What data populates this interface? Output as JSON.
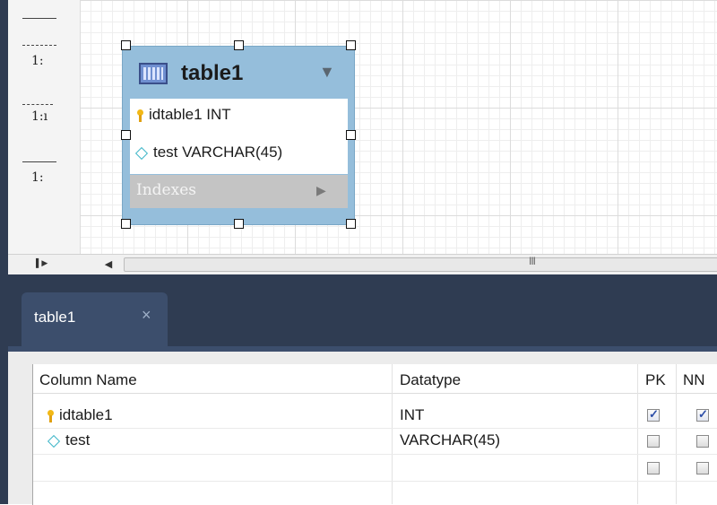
{
  "palette": {
    "items": [
      {
        "label": "1:"
      },
      {
        "label": "1:ı"
      },
      {
        "label": "1:"
      }
    ]
  },
  "entity": {
    "title": "table1",
    "columns": [
      {
        "text": "idtable1 INT",
        "icon": "key-icon"
      },
      {
        "text": "test VARCHAR(45)",
        "icon": "diamond-icon"
      }
    ],
    "indexes_label": "Indexes"
  },
  "scrollbar": {
    "grip": "III"
  },
  "tab": {
    "label": "table1",
    "close": "×"
  },
  "column_grid": {
    "headers": {
      "name": "Column Name",
      "datatype": "Datatype",
      "pk": "PK",
      "nn": "NN"
    },
    "rows": [
      {
        "name": "idtable1",
        "datatype": "INT",
        "pk": true,
        "nn": true,
        "icon": "key-icon"
      },
      {
        "name": "test",
        "datatype": "VARCHAR(45)",
        "pk": false,
        "nn": false,
        "icon": "diamond-icon"
      },
      {
        "name": "",
        "datatype": "",
        "pk": false,
        "nn": false,
        "icon": ""
      }
    ]
  },
  "colors": {
    "frame": "#2f3c52",
    "tab": "#3c4e6c",
    "entity": "#95bedb"
  }
}
